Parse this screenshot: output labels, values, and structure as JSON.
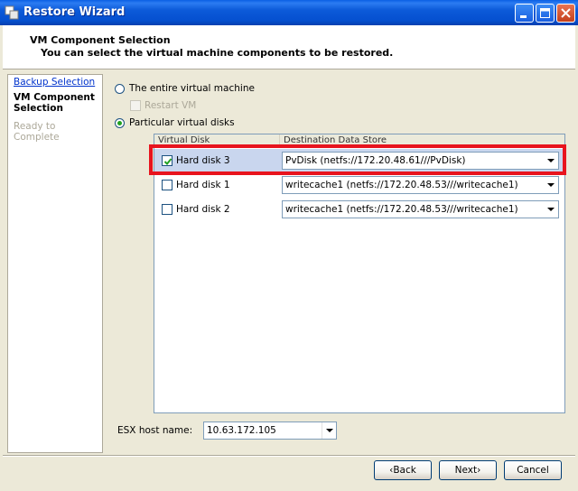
{
  "window": {
    "title": "Restore Wizard",
    "icons": {
      "app": "vmware-logo-icon",
      "minimize": "minimize-icon",
      "maximize": "maximize-icon",
      "close": "close-icon"
    }
  },
  "header": {
    "title": "VM Component Selection",
    "subtitle": "You can select the virtual machine components to be restored."
  },
  "nav": {
    "items": [
      {
        "label": "Backup Selection",
        "state": "link"
      },
      {
        "label": "VM Component Selection",
        "state": "current"
      },
      {
        "label": "Ready to Complete",
        "state": "disabled"
      }
    ]
  },
  "options": {
    "entire_vm": {
      "label": "The entire virtual machine",
      "selected": false
    },
    "restart_vm": {
      "label": "Restart VM",
      "checked": false,
      "enabled": false
    },
    "particular_disks": {
      "label": "Particular virtual disks",
      "selected": true
    }
  },
  "disk_table": {
    "columns": [
      "Virtual Disk",
      "Destination Data Store"
    ],
    "rows": [
      {
        "disk": "Hard disk 3",
        "checked": true,
        "datastore": "PvDisk (netfs://172.20.48.61///PvDisk)",
        "selected": true
      },
      {
        "disk": "Hard disk 1",
        "checked": false,
        "datastore": "writecache1 (netfs://172.20.48.53///writecache1)",
        "selected": false
      },
      {
        "disk": "Hard disk 2",
        "checked": false,
        "datastore": "writecache1 (netfs://172.20.48.53///writecache1)",
        "selected": false
      }
    ]
  },
  "esx_host": {
    "label": "ESX host name:",
    "value": "10.63.172.105"
  },
  "buttons": {
    "back": "‹Back",
    "next": "Next›",
    "cancel": "Cancel"
  },
  "colors": {
    "titlebar": "#0550D0",
    "highlight": "#E8141E",
    "selected_row": "#C9D6EE",
    "dialog_bg": "#ECE9D8"
  }
}
